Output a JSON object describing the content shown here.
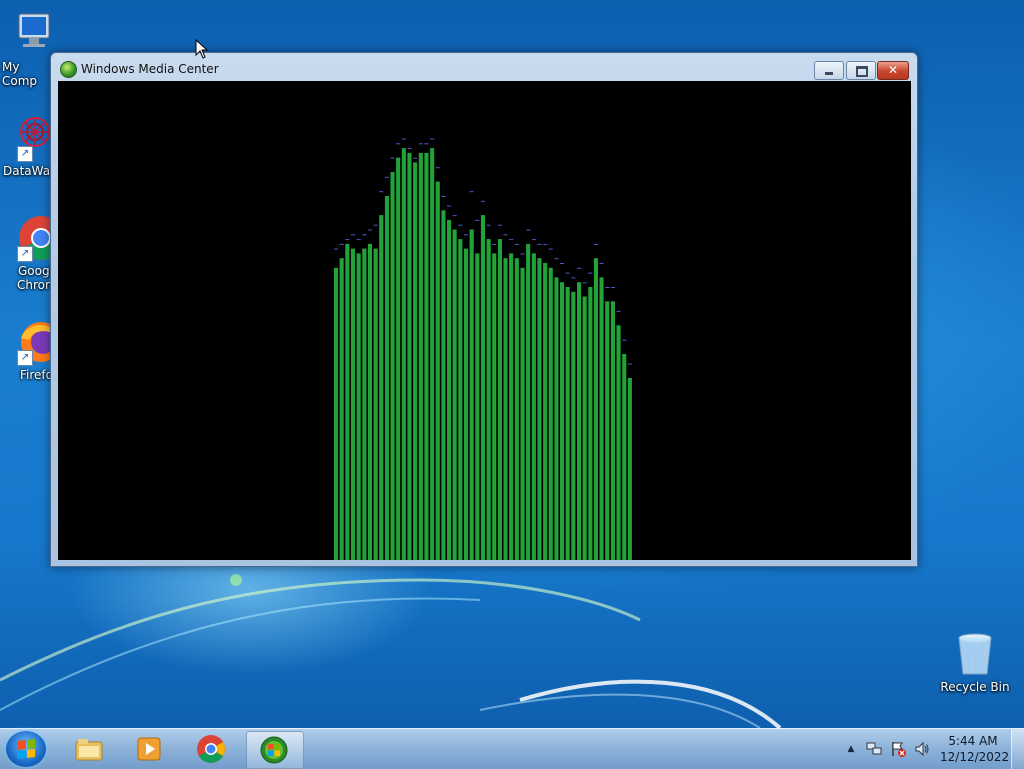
{
  "desktop": {
    "icons": [
      {
        "label": "My Comp",
        "icon": "computer-icon"
      },
      {
        "label": "DataWag",
        "icon": "datawag-icon"
      },
      {
        "label": "Googl\nChron",
        "line1": "Googl",
        "line2": "Chron",
        "icon": "chrome-icon"
      },
      {
        "label": "Firefo",
        "icon": "firefox-icon"
      },
      {
        "label": "Recycle Bin",
        "icon": "recycle-bin-icon"
      }
    ]
  },
  "window": {
    "title": "Windows Media Center",
    "icon": "media-center-icon",
    "controls": {
      "minimize": "minimize",
      "maximize": "maximize",
      "close": "✕"
    },
    "visualizer": {
      "bar_color": "#22a33a",
      "peak_color": "#4a5ac8",
      "levels": [
        0.61,
        0.63,
        0.66,
        0.65,
        0.64,
        0.65,
        0.66,
        0.65,
        0.72,
        0.76,
        0.81,
        0.84,
        0.86,
        0.85,
        0.83,
        0.85,
        0.85,
        0.86,
        0.79,
        0.73,
        0.71,
        0.69,
        0.67,
        0.65,
        0.69,
        0.64,
        0.72,
        0.67,
        0.64,
        0.67,
        0.63,
        0.64,
        0.63,
        0.61,
        0.66,
        0.64,
        0.63,
        0.62,
        0.61,
        0.59,
        0.58,
        0.57,
        0.56,
        0.58,
        0.55,
        0.57,
        0.63,
        0.59,
        0.54,
        0.54,
        0.49,
        0.43,
        0.38
      ],
      "peaks": [
        0.65,
        0.66,
        0.67,
        0.68,
        0.67,
        0.68,
        0.69,
        0.7,
        0.77,
        0.8,
        0.84,
        0.87,
        0.88,
        0.86,
        0.84,
        0.87,
        0.87,
        0.88,
        0.82,
        0.76,
        0.74,
        0.72,
        0.7,
        0.68,
        0.77,
        0.71,
        0.75,
        0.7,
        0.66,
        0.7,
        0.68,
        0.67,
        0.66,
        0.64,
        0.69,
        0.67,
        0.66,
        0.66,
        0.65,
        0.63,
        0.62,
        0.6,
        0.59,
        0.61,
        0.58,
        0.6,
        0.66,
        0.62,
        0.57,
        0.57,
        0.52,
        0.46,
        0.41
      ]
    }
  },
  "taskbar": {
    "start_icon": "windows-start-icon",
    "pinned": [
      {
        "name": "explorer",
        "icon": "folder-icon",
        "active": false
      },
      {
        "name": "media-player",
        "icon": "media-player-icon",
        "active": false
      },
      {
        "name": "chrome",
        "icon": "chrome-icon",
        "active": false
      },
      {
        "name": "media-center",
        "icon": "media-center-icon",
        "active": true
      }
    ],
    "tray": {
      "expand": "▲",
      "time": "5:44 AM",
      "date": "12/12/2022"
    }
  }
}
